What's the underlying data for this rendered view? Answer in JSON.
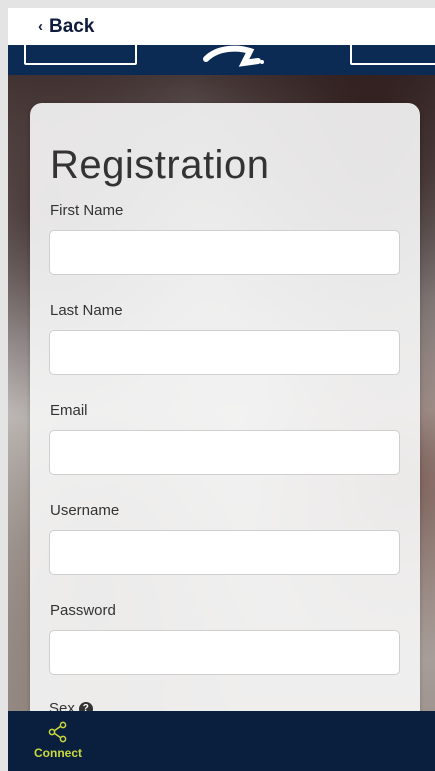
{
  "topbar": {
    "back_label": "Back"
  },
  "form": {
    "title": "Registration",
    "fields": [
      {
        "label": "First Name",
        "value": ""
      },
      {
        "label": "Last Name",
        "value": ""
      },
      {
        "label": "Email",
        "value": ""
      },
      {
        "label": "Username",
        "value": ""
      },
      {
        "label": "Password",
        "value": ""
      }
    ],
    "sex_label": "Sex"
  },
  "bottom_nav": {
    "connect_label": "Connect"
  },
  "colors": {
    "navy": "#0c2b54",
    "nav_bg": "#0a1f3e",
    "accent": "#c9d93c"
  }
}
